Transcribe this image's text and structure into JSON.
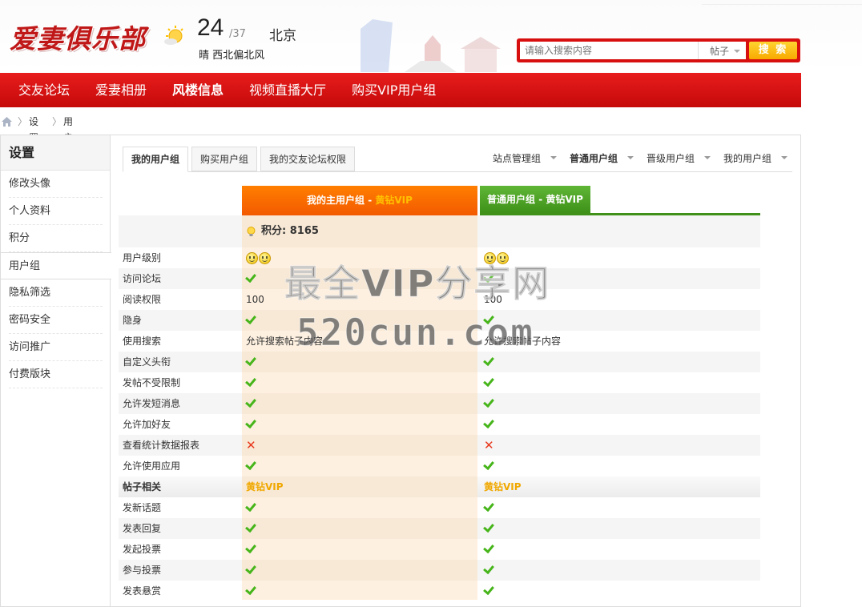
{
  "header": {
    "logo_text": "爱妻俱乐部",
    "temperature": "24",
    "temp_range": "/37",
    "city": "北京",
    "weather_desc": "晴 西北偏北风"
  },
  "search": {
    "placeholder": "请输入搜索内容",
    "type_select": "帖子",
    "button_label": "搜 索"
  },
  "nav": {
    "items": [
      "交友论坛",
      "爱妻相册",
      "风楼信息",
      "视频直播大厅",
      "购买VIP用户组"
    ],
    "active_index": 2
  },
  "breadcrumb": {
    "items": [
      "设置",
      "用户组"
    ]
  },
  "sidebar": {
    "title": "设置",
    "items": [
      "修改头像",
      "个人资料",
      "积分",
      "用户组",
      "隐私筛选",
      "密码安全",
      "访问推广",
      "付费版块"
    ],
    "active_index": 3
  },
  "tabs": {
    "left": [
      "我的用户组",
      "购买用户组",
      "我的交友论坛权限"
    ],
    "right": [
      "站点管理组",
      "普通用户组",
      "晋级用户组",
      "我的用户组"
    ]
  },
  "columns": {
    "col1_title": "我的主用户组 - ",
    "col1_vip": "黄钻VIP",
    "col2_title": "普通用户组 - 黄钻VIP"
  },
  "score": {
    "label": "积分: 8165"
  },
  "rows": [
    {
      "label": "用户级别",
      "c1": "smile",
      "c2": "smile"
    },
    {
      "label": "访问论坛",
      "c1": "check",
      "c2": "check"
    },
    {
      "label": "阅读权限",
      "c1": "100",
      "c2": "100"
    },
    {
      "label": "隐身",
      "c1": "check",
      "c2": "check"
    },
    {
      "label": "使用搜索",
      "c1": "允许搜索帖子内容",
      "c2": "允许搜索帖子内容"
    },
    {
      "label": "自定义头衔",
      "c1": "check",
      "c2": "check"
    },
    {
      "label": "发帖不受限制",
      "c1": "check",
      "c2": "check"
    },
    {
      "label": "允许发短消息",
      "c1": "check",
      "c2": "check"
    },
    {
      "label": "允许加好友",
      "c1": "check",
      "c2": "check"
    },
    {
      "label": "查看统计数据报表",
      "c1": "cross",
      "c2": "cross"
    },
    {
      "label": "允许使用应用",
      "c1": "check",
      "c2": "check"
    }
  ],
  "section": {
    "label": "帖子相关",
    "c1": "黄钻VIP",
    "c2": "黄钻VIP"
  },
  "rows2": [
    {
      "label": "发新话题",
      "c1": "check",
      "c2": "check"
    },
    {
      "label": "发表回复",
      "c1": "check",
      "c2": "check"
    },
    {
      "label": "发起投票",
      "c1": "check",
      "c2": "check"
    },
    {
      "label": "参与投票",
      "c1": "check",
      "c2": "check"
    },
    {
      "label": "发表悬赏",
      "c1": "check",
      "c2": "check"
    }
  ],
  "watermark": {
    "line1": "最全VIP分享网",
    "line2": "520cun.com"
  },
  "colors": {
    "brand_red": "#d80f0f",
    "orange": "#f35a00",
    "green": "#3f9119",
    "vip_gold": "#f0a800"
  }
}
